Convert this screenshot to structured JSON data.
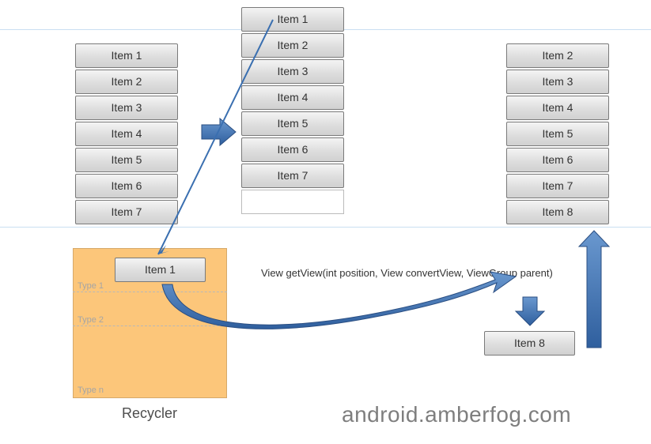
{
  "lists": {
    "left": [
      "Item 1",
      "Item 2",
      "Item 3",
      "Item 4",
      "Item 5",
      "Item 6",
      "Item 7"
    ],
    "middle": [
      "Item 1",
      "Item 2",
      "Item 3",
      "Item 4",
      "Item 5",
      "Item 6",
      "Item 7"
    ],
    "right": [
      "Item 2",
      "Item 3",
      "Item 4",
      "Item 5",
      "Item 6",
      "Item 7",
      "Item 8"
    ]
  },
  "recycler": {
    "item_label": "Item 1",
    "type_labels": [
      "Type 1",
      "Type 2",
      "Type n"
    ],
    "caption": "Recycler"
  },
  "floating_item": "Item 8",
  "method_signature": "View getView(int position, View convertView, ViewGroup parent)",
  "watermark": "android.amberfog.com"
}
